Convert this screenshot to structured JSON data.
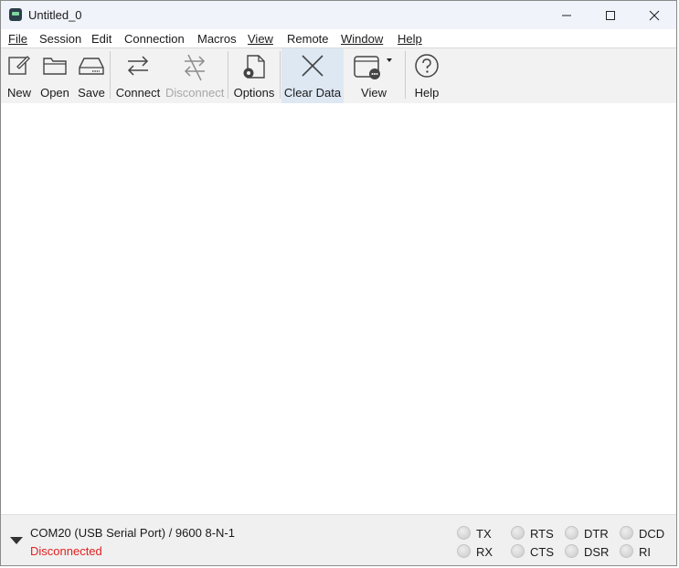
{
  "window": {
    "title": "Untitled_0"
  },
  "menu": [
    {
      "label": "File"
    },
    {
      "label": "Session"
    },
    {
      "label": "Edit"
    },
    {
      "label": "Connection"
    },
    {
      "label": "Macros"
    },
    {
      "label": "View"
    },
    {
      "label": "Remote"
    },
    {
      "label": "Window"
    },
    {
      "label": "Help"
    }
  ],
  "toolbar": {
    "new": "New",
    "open": "Open",
    "save": "Save",
    "connect": "Connect",
    "disconnect": "Disconnect",
    "options": "Options",
    "clear_data": "Clear Data",
    "view": "View",
    "help": "Help"
  },
  "status": {
    "port": "COM20 (USB Serial Port) / 9600 8-N-1",
    "connection": "Disconnected",
    "connection_color": "#e02020",
    "signals": [
      "TX",
      "RX",
      "RTS",
      "CTS",
      "DTR",
      "DSR",
      "DCD",
      "RI"
    ]
  }
}
